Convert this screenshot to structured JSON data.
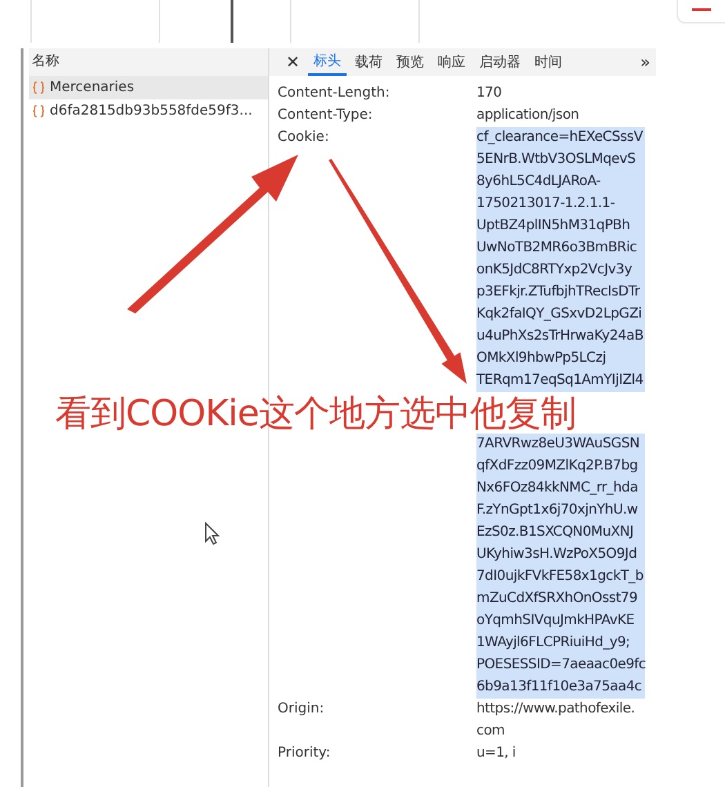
{
  "requests": {
    "header": "名称",
    "items": [
      {
        "name": "Mercenaries",
        "selected": true
      },
      {
        "name": "d6fa2815db93b558fde59f3...",
        "selected": false
      }
    ]
  },
  "tabs": [
    {
      "label": "标头",
      "selected": true
    },
    {
      "label": "载荷",
      "selected": false
    },
    {
      "label": "预览",
      "selected": false
    },
    {
      "label": "响应",
      "selected": false
    },
    {
      "label": "启动器",
      "selected": false
    },
    {
      "label": "时间",
      "selected": false
    }
  ],
  "close_icon": "✕",
  "more_tabs": "»",
  "headers": [
    {
      "name": "Content-Length:",
      "values": [
        "170"
      ],
      "highlighted": false
    },
    {
      "name": "Content-Type:",
      "values": [
        "application/json"
      ],
      "highlighted": false
    },
    {
      "name": "Cookie:",
      "values": [
        "cf_clearance=hEXeCSssV",
        "5ENrB.WtbV3OSLMqevS",
        "8y6hL5C4dLJARoA-",
        "1750213017-1.2.1.1-",
        "UptBZ4plIN5hM31qPBh",
        "UwNoTB2MR6o3BmBRic",
        "onK5JdC8RTYxp2VcJv3y",
        "p3EFkjr.ZTufbjhTRecIsDTr",
        "Kqk2faIQY_GSxvD2LpGZi",
        "u4uPhXs2sTrHrwaKy24aB",
        "OMkXl9hbwPp5LCzj",
        "TERqm17eqSq1AmYIjIZl4"
      ],
      "continued": [
        "7ARVRwz8eU3WAuSGSN",
        "qfXdFzz09MZlKq2P.B7bg",
        "Nx6FOz84kkNMC_rr_hda",
        "F.zYnGpt1x6j70xjnYhU.w",
        "EzS0z.B1SXCQN0MuXNJ",
        "UKyhiw3sH.WzPoX5O9Jd",
        "7dI0ujkFVkFE58x1gckT_b",
        "mZuCdXfSRXhOnOsst79",
        "oYqmhSIVquJmkHPAvKE",
        "1WAyjl6FLCPRiuiHd_y9;",
        "POESESSID=7aeaac0e9fc",
        "6b9a13f11f10e3a75aa4c"
      ],
      "highlighted": true
    },
    {
      "name": "Origin:",
      "values": [
        "https://www.pathofexile.",
        "com"
      ],
      "highlighted": false
    },
    {
      "name": "Priority:",
      "values": [
        "u=1, i"
      ],
      "highlighted": false
    }
  ],
  "annotation": {
    "text": "看到COOKie这个地方选中他复制",
    "color": "#d93a2f"
  }
}
